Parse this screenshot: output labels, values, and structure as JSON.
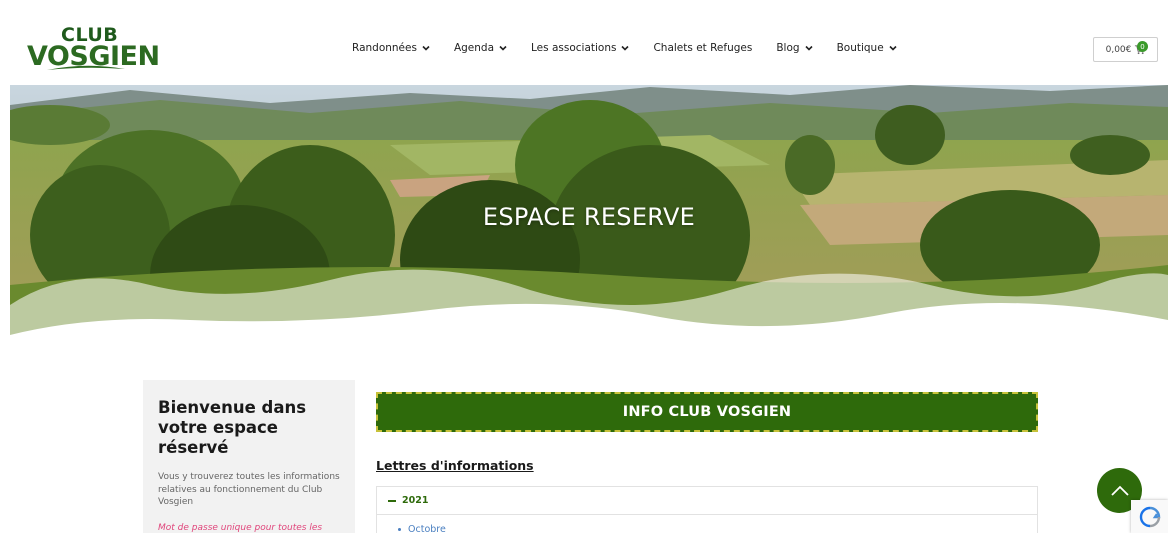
{
  "logo": {
    "line1": "CLUB",
    "line2": "VOSGIEN"
  },
  "nav": [
    {
      "label": "Randonnées",
      "has_dropdown": true
    },
    {
      "label": "Agenda",
      "has_dropdown": true
    },
    {
      "label": "Les associations",
      "has_dropdown": true
    },
    {
      "label": "Chalets et Refuges",
      "has_dropdown": false
    },
    {
      "label": "Blog",
      "has_dropdown": true
    },
    {
      "label": "Boutique",
      "has_dropdown": true
    }
  ],
  "cart": {
    "amount": "0,00€",
    "count": "0"
  },
  "hero": {
    "title": "ESPACE RESERVE"
  },
  "sidebar": {
    "title": "Bienvenue dans votre espace réservé",
    "text": "Vous y trouverez toutes les informations relatives au fonctionnement du Club Vosgien",
    "note": "Mot de passe unique pour toutes les associations locales du Club Vosgien"
  },
  "main": {
    "banner": "INFO CLUB VOSGIEN",
    "section_title": "Lettres d'informations",
    "accordion": {
      "year": "2021",
      "items": [
        "Octobre"
      ]
    }
  },
  "colors": {
    "brand_green": "#2e6a0b",
    "link_blue": "#4a7fc0",
    "note_pink": "#e0457b"
  },
  "icons": {
    "scroll_top": "chevron-up-icon",
    "cart": "cart-icon",
    "dropdown": "chevron-down-icon",
    "recaptcha": "recaptcha-icon"
  }
}
